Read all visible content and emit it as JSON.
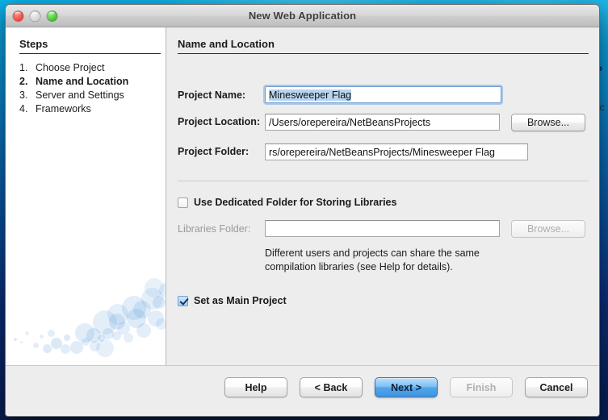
{
  "window": {
    "title": "New Web Application",
    "traffic_lights": [
      {
        "name": "close",
        "color": "#e8473c"
      },
      {
        "name": "minimize",
        "color": "#d2d2d2"
      },
      {
        "name": "zoom",
        "color": "#3fbe2c"
      }
    ]
  },
  "steps": {
    "heading": "Steps",
    "items": [
      {
        "num": "1.",
        "label": "Choose Project",
        "current": false
      },
      {
        "num": "2.",
        "label": "Name and Location",
        "current": true
      },
      {
        "num": "3.",
        "label": "Server and Settings",
        "current": false
      },
      {
        "num": "4.",
        "label": "Frameworks",
        "current": false
      }
    ]
  },
  "panel": {
    "heading": "Name and Location",
    "fields": [
      {
        "label": "Project Name:",
        "value": "Minesweeper Flag",
        "placeholder": "",
        "selected": true,
        "focused": true,
        "enabled": true
      },
      {
        "label": "Project Location:",
        "value": "/Users/orepereira/NetBeansProjects",
        "placeholder": "",
        "selected": false,
        "focused": false,
        "enabled": true,
        "browse_label": "Browse...",
        "browse_enabled": true
      },
      {
        "label": "Project Folder:",
        "value": "rs/orepereira/NetBeansProjects/Minesweeper Flag",
        "placeholder": "",
        "selected": false,
        "focused": false,
        "enabled": true
      }
    ],
    "dedicated_folder_checkbox": {
      "label": "Use Dedicated Folder for Storing Libraries",
      "checked": false
    },
    "libraries_folder": {
      "label": "Libraries Folder:",
      "value": "",
      "placeholder": "",
      "enabled": false,
      "browse_label": "Browse...",
      "browse_enabled": false
    },
    "help_text": "Different users and projects can share the same compilation libraries (see Help for details).",
    "main_project_checkbox": {
      "label": "Set as Main Project",
      "checked": true
    }
  },
  "footer": {
    "buttons": [
      {
        "label": "Help",
        "state": "normal"
      },
      {
        "label": "< Back",
        "state": "normal"
      },
      {
        "label": "Next >",
        "state": "default"
      },
      {
        "label": "Finish",
        "state": "disabled"
      },
      {
        "label": "Cancel",
        "state": "normal"
      }
    ]
  },
  "behind_window": {
    "glyph_1": "P",
    "glyph_2": "oc"
  },
  "colors": {
    "accent": "#3d92e0",
    "selection": "#b8d4ef",
    "dialog_bg": "#ededed",
    "panel_bg": "#ffffff",
    "desktop": "#0a5ba8"
  }
}
